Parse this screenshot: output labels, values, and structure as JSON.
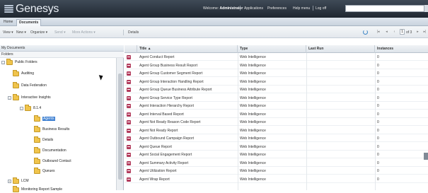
{
  "header": {
    "logo_text": "Genesys",
    "welcome_prefix": "Welcome:",
    "welcome_user": "Administrator",
    "nav": [
      "Applications",
      "Preferences",
      "Help menu",
      "Log off"
    ]
  },
  "tabs": [
    {
      "label": "Home",
      "active": false
    },
    {
      "label": "Documents",
      "active": true
    }
  ],
  "toolbar": {
    "view": "View",
    "new": "New",
    "organize": "Organize",
    "send": "Send",
    "more_actions": "More Actions",
    "details": "Details",
    "page_current": "1",
    "page_of": "of 3"
  },
  "left": {
    "header": "My Documents",
    "subheader": "Folders",
    "tree": [
      {
        "label": "Public Folders",
        "toggle": "-",
        "level": 0
      },
      {
        "label": "Auditing",
        "toggle": "",
        "level": 1
      },
      {
        "label": "Data Federation",
        "toggle": "",
        "level": 1
      },
      {
        "label": "Interactive Insights",
        "toggle": "-",
        "level": 1
      },
      {
        "label": "8.1.4",
        "toggle": "-",
        "level": 2
      },
      {
        "label": "Agents",
        "toggle": "",
        "level": 3,
        "selected": true
      },
      {
        "label": "Business Results",
        "toggle": "",
        "level": 3
      },
      {
        "label": "Details",
        "toggle": "",
        "level": 3
      },
      {
        "label": "Documentation",
        "toggle": "",
        "level": 3
      },
      {
        "label": "Outbound Contact",
        "toggle": "",
        "level": 3
      },
      {
        "label": "Queues",
        "toggle": "",
        "level": 3
      },
      {
        "label": "LCM",
        "toggle": "+",
        "level": 1
      },
      {
        "label": "Monitoring Report Sample",
        "toggle": "",
        "level": 1
      }
    ]
  },
  "grid": {
    "columns": [
      "Title ▲",
      "Type",
      "Last Run",
      "Instances"
    ],
    "rows": [
      {
        "title": "Agent Conduct Report",
        "type": "Web Intelligence",
        "last_run": "",
        "instances": "0"
      },
      {
        "title": "Agent Group Business Result Report",
        "type": "Web Intelligence",
        "last_run": "",
        "instances": "0"
      },
      {
        "title": "Agent Group Customer Segment Report",
        "type": "Web Intelligence",
        "last_run": "",
        "instances": "0"
      },
      {
        "title": "Agent Group Interaction Handling Report",
        "type": "Web Intelligence",
        "last_run": "",
        "instances": "0"
      },
      {
        "title": "Agent Group Queue Business Attribute Report",
        "type": "Web Intelligence",
        "last_run": "",
        "instances": "0"
      },
      {
        "title": "Agent Group Service Type Report",
        "type": "Web Intelligence",
        "last_run": "",
        "instances": "0"
      },
      {
        "title": "Agent Interaction Hierarchy Report",
        "type": "Web Intelligence",
        "last_run": "",
        "instances": "0"
      },
      {
        "title": "Agent Interval Based Report",
        "type": "Web Intelligence",
        "last_run": "",
        "instances": "0"
      },
      {
        "title": "Agent Not Ready Reason Code Report",
        "type": "Web Intelligence",
        "last_run": "",
        "instances": "0"
      },
      {
        "title": "Agent Not Ready Report",
        "type": "Web Intelligence",
        "last_run": "",
        "instances": "0"
      },
      {
        "title": "Agent Outbound Campaign Report",
        "type": "Web Intelligence",
        "last_run": "",
        "instances": "0"
      },
      {
        "title": "Agent Queue Report",
        "type": "Web Intelligence",
        "last_run": "",
        "instances": "0"
      },
      {
        "title": "Agent Social Engagement Report",
        "type": "Web Intelligence",
        "last_run": "",
        "instances": "0"
      },
      {
        "title": "Agent Summary Activity Report",
        "type": "Web Intelligence",
        "last_run": "",
        "instances": "0"
      },
      {
        "title": "Agent Utilization Report",
        "type": "Web Intelligence",
        "last_run": "",
        "instances": "0"
      },
      {
        "title": "Agent Wrap Report",
        "type": "Web Intelligence",
        "last_run": "",
        "instances": "0"
      }
    ]
  }
}
